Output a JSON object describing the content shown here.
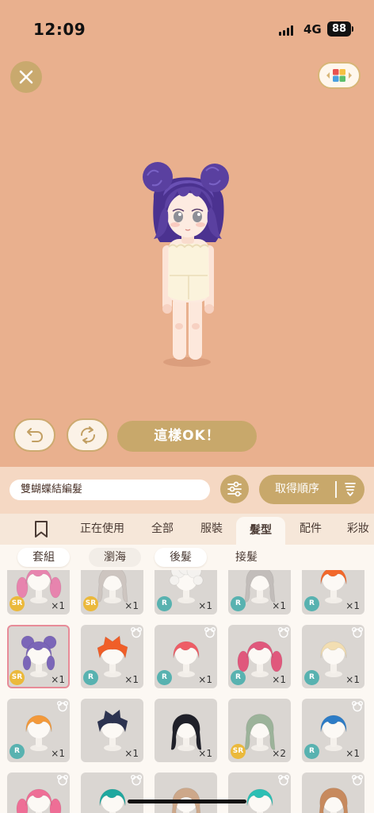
{
  "status_bar": {
    "time": "12:09",
    "network": "4G",
    "battery": "88"
  },
  "top": {
    "close_icon": "close-icon",
    "palette_icon": "color-grid-icon"
  },
  "actions": {
    "undo_icon": "undo-icon",
    "rotate_icon": "rotate-icon",
    "confirm_label": "這樣OK！"
  },
  "search": {
    "value": "雙蝴蝶結編髮",
    "filter_icon": "filter-sliders-icon"
  },
  "sort": {
    "label": "取得順序",
    "icon": "sort-icon"
  },
  "tabs": {
    "bookmark_icon": "bookmark-icon",
    "items": [
      {
        "label": "正在使用"
      },
      {
        "label": "全部"
      },
      {
        "label": "服裝"
      },
      {
        "label": "髮型",
        "selected": true
      },
      {
        "label": "配件"
      },
      {
        "label": "彩妝"
      }
    ]
  },
  "subtabs": [
    {
      "label": "套組"
    },
    {
      "label": "瀏海"
    },
    {
      "label": "後髮"
    },
    {
      "label": "接髮"
    }
  ],
  "items": [
    {
      "rarity": "SR",
      "count": "×1",
      "hair_color": "#E784AE",
      "bear_icon": false
    },
    {
      "rarity": "SR",
      "count": "×1",
      "hair_color": "#CDC5C0",
      "bear_icon": false
    },
    {
      "rarity": "R",
      "count": "×1",
      "hair_color": "#F4F2EF",
      "bear_icon": false
    },
    {
      "rarity": "R",
      "count": "×1",
      "hair_color": "#C2BDBA",
      "bear_icon": false
    },
    {
      "rarity": "R",
      "count": "×1",
      "hair_color": "#F2682B",
      "bear_icon": false
    },
    {
      "rarity": "SR",
      "count": "×1",
      "hair_color": "#7B66B8",
      "bear_icon": false,
      "selected": true
    },
    {
      "rarity": "R",
      "count": "×1",
      "hair_color": "#F05E28",
      "bear_icon": true
    },
    {
      "rarity": "R",
      "count": "×1",
      "hair_color": "#EE5D66",
      "bear_icon": true
    },
    {
      "rarity": "R",
      "count": "×1",
      "hair_color": "#E0587C",
      "bear_icon": true
    },
    {
      "rarity": "R",
      "count": "×1",
      "hair_color": "#F2DEB2",
      "bear_icon": true
    },
    {
      "rarity": "R",
      "count": "×1",
      "hair_color": "#F3993A",
      "bear_icon": true
    },
    {
      "count": "×1",
      "hair_color": "#2C3350",
      "bear_icon": false
    },
    {
      "count": "×1",
      "hair_color": "#1F2029",
      "bear_icon": false
    },
    {
      "rarity": "SR",
      "count": "×2",
      "hair_color": "#9CB39A",
      "bear_icon": false
    },
    {
      "rarity": "R",
      "count": "×1",
      "hair_color": "#2D7CC6",
      "bear_icon": true
    },
    {
      "hair_color": "#EE6E96",
      "bear_icon": true
    },
    {
      "hair_color": "#20A89F",
      "bear_icon": true
    },
    {
      "hair_color": "#CDA88A",
      "bear_icon": false
    },
    {
      "hair_color": "#2CBFB4",
      "bear_icon": true
    },
    {
      "hair_color": "#C78A5E",
      "bear_icon": true
    }
  ],
  "colors": {
    "background": "#E9B08E",
    "accent_gold": "#C8A86B",
    "rarity_sr": "#EBB93B",
    "rarity_r": "#58B2B0",
    "selected_border": "#E88B98",
    "avatar_hair": "#5A40A0"
  }
}
